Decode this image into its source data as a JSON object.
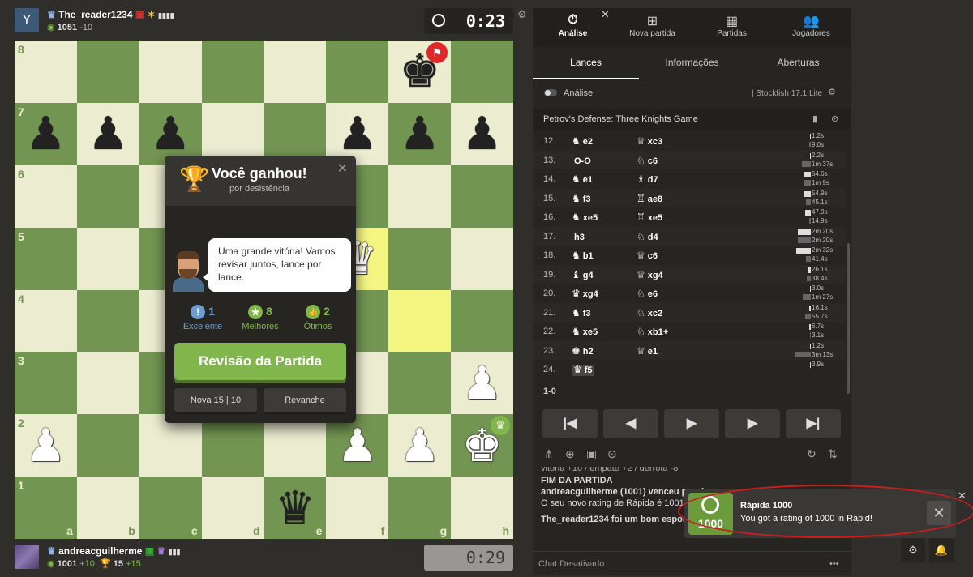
{
  "top_player": {
    "avatar_letter": "Y",
    "name": "The_reader1234",
    "rating": "1051",
    "delta": "-10",
    "clock": "0:23"
  },
  "bottom_player": {
    "name": "andreacguilherme",
    "rating": "1001",
    "delta": "+10",
    "trophies": "15",
    "trophies_delta": "+15",
    "clock": "0:29"
  },
  "board": {
    "ranks": [
      "8",
      "7",
      "6",
      "5",
      "4",
      "3",
      "2",
      "1"
    ],
    "files": [
      "a",
      "b",
      "c",
      "d",
      "e",
      "f",
      "g",
      "h"
    ],
    "pieces": [
      {
        "sq": "g8",
        "glyph": "♚",
        "color": "black",
        "name": "black-king"
      },
      {
        "sq": "a7",
        "glyph": "♟",
        "color": "black",
        "name": "black-pawn-a7"
      },
      {
        "sq": "b7",
        "glyph": "♟",
        "color": "black",
        "name": "black-pawn-b7"
      },
      {
        "sq": "c7",
        "glyph": "♟",
        "color": "black",
        "name": "black-pawn-c7"
      },
      {
        "sq": "f7",
        "glyph": "♟",
        "color": "black",
        "name": "black-pawn-f7"
      },
      {
        "sq": "g7",
        "glyph": "♟",
        "color": "black",
        "name": "black-pawn-g7"
      },
      {
        "sq": "h7",
        "glyph": "♟",
        "color": "black",
        "name": "black-pawn-h7"
      },
      {
        "sq": "f5",
        "glyph": "♛",
        "color": "white",
        "name": "white-queen"
      },
      {
        "sq": "h3",
        "glyph": "♟",
        "color": "white",
        "name": "white-pawn-h3"
      },
      {
        "sq": "a2",
        "glyph": "♟",
        "color": "white",
        "name": "white-pawn-a2"
      },
      {
        "sq": "f2",
        "glyph": "♟",
        "color": "white",
        "name": "white-pawn-f2"
      },
      {
        "sq": "g2",
        "glyph": "♟",
        "color": "white",
        "name": "white-pawn-g2"
      },
      {
        "sq": "h2",
        "glyph": "♚",
        "color": "white",
        "name": "white-king"
      },
      {
        "sq": "e1",
        "glyph": "♛",
        "color": "black",
        "name": "black-queen"
      }
    ],
    "highlight": [
      "f5",
      "g4"
    ]
  },
  "modal": {
    "title": "Você ganhou!",
    "subtitle": "por desistência",
    "coach_message": "Uma grande vitória! Vamos revisar juntos, lance por lance.",
    "stats": [
      {
        "count": "1",
        "label": "Excelente",
        "color": "#6c9ccf",
        "glyph": "!"
      },
      {
        "count": "8",
        "label": "Melhores",
        "color": "#81b64c",
        "glyph": "★"
      },
      {
        "count": "2",
        "label": "Ótimos",
        "color": "#81b64c",
        "glyph": "👍"
      }
    ],
    "review_button": "Revisão da Partida",
    "new_game_button": "Nova 15 | 10",
    "rematch_button": "Revanche"
  },
  "panel": {
    "nav": [
      {
        "label": "Análise",
        "icon": "⏱"
      },
      {
        "label": "Nova partida",
        "icon": "⊞"
      },
      {
        "label": "Partidas",
        "icon": "▦"
      },
      {
        "label": "Jogadores",
        "icon": "👥"
      }
    ],
    "tabs": [
      "Lances",
      "Informações",
      "Aberturas"
    ],
    "analysis_label": "Análise",
    "engine": "Stockfish 17.1 Lite",
    "opening": "Petrov's Defense: Three Knights Game",
    "moves": [
      {
        "num": "12.",
        "wp": "♞",
        "w": "e2",
        "bp": "♕",
        "b": "xc3",
        "tw": "1.2s",
        "tb": "9.0s",
        "bw": 0.02,
        "bb": 0.05
      },
      {
        "num": "13.",
        "wp": "",
        "w": "O-O",
        "bp": "♘",
        "b": "c6",
        "tw": "2.2s",
        "tb": "1m 37s",
        "bw": 0.03,
        "bb": 0.28
      },
      {
        "num": "14.",
        "wp": "♞",
        "w": "e1",
        "bp": "♗",
        "b": "d7",
        "tw": "54.6s",
        "tb": "1m 9s",
        "bw": 0.19,
        "bb": 0.2
      },
      {
        "num": "15.",
        "wp": "♞",
        "w": "f3",
        "bp": "♖",
        "b": "ae8",
        "tw": "54.9s",
        "tb": "45.1s",
        "bw": 0.19,
        "bb": 0.15
      },
      {
        "num": "16.",
        "wp": "♞",
        "w": "xe5",
        "bp": "♖",
        "b": "xe5",
        "tw": "47.9s",
        "tb": "14.9s",
        "bw": 0.17,
        "bb": 0.06
      },
      {
        "num": "17.",
        "wp": "",
        "w": "h3",
        "bp": "♘",
        "b": "d4",
        "tw": "2m 20s",
        "tb": "2m 20s",
        "bw": 0.4,
        "bb": 0.4
      },
      {
        "num": "18.",
        "wp": "♞",
        "w": "b1",
        "bp": "♕",
        "b": "c6",
        "tw": "2m 32s",
        "tb": "41.4s",
        "bw": 0.44,
        "bb": 0.14
      },
      {
        "num": "19.",
        "wp": "♝",
        "w": "g4",
        "bp": "♕",
        "b": "xg4",
        "tw": "26.1s",
        "tb": "38.4s",
        "bw": 0.1,
        "bb": 0.13
      },
      {
        "num": "20.",
        "wp": "♛",
        "w": "xg4",
        "bp": "♘",
        "b": "e6",
        "tw": "3.0s",
        "tb": "1m 27s",
        "bw": 0.03,
        "bb": 0.26
      },
      {
        "num": "21.",
        "wp": "♞",
        "w": "f3",
        "bp": "♘",
        "b": "xc2",
        "tw": "16.1s",
        "tb": "55.7s",
        "bw": 0.06,
        "bb": 0.17
      },
      {
        "num": "22.",
        "wp": "♞",
        "w": "xe5",
        "bp": "♘",
        "b": "xb1+",
        "tw": "6.7s",
        "tb": "3.1s",
        "bw": 0.04,
        "bb": 0.03
      },
      {
        "num": "23.",
        "wp": "♚",
        "w": "h2",
        "bp": "♕",
        "b": "e1",
        "tw": "1.2s",
        "tb": "3m 13s",
        "bw": 0.02,
        "bb": 0.5
      },
      {
        "num": "24.",
        "wp": "♛",
        "w": "f5",
        "bp": "",
        "b": "",
        "tw": "3.9s",
        "tb": "",
        "bw": 0.02,
        "bb": 0
      }
    ],
    "result": "1-0",
    "nav_buttons": [
      "|◀",
      "◀",
      "▶",
      "▶",
      "▶|"
    ],
    "chat_lines": {
      "line0": "vitória +10 / empate +2 / derrota -8",
      "line1": "FIM DA PARTIDA",
      "line2": "andreacguilherme (1001) venceu por d",
      "line3": "O seu novo rating de Rápida é 1001 (+",
      "line4": "The_reader1234 foi um bom esportist"
    },
    "chat_disabled": "Chat Desativado"
  },
  "toast": {
    "badge_number": "1000",
    "title": "Rápida 1000",
    "text": "You got a rating of 1000 in Rapid!"
  },
  "colors": {
    "light_square": "#ebecd0",
    "dark_square": "#739552",
    "accent_green": "#81b64c",
    "annotation_red": "#c81e1e"
  }
}
